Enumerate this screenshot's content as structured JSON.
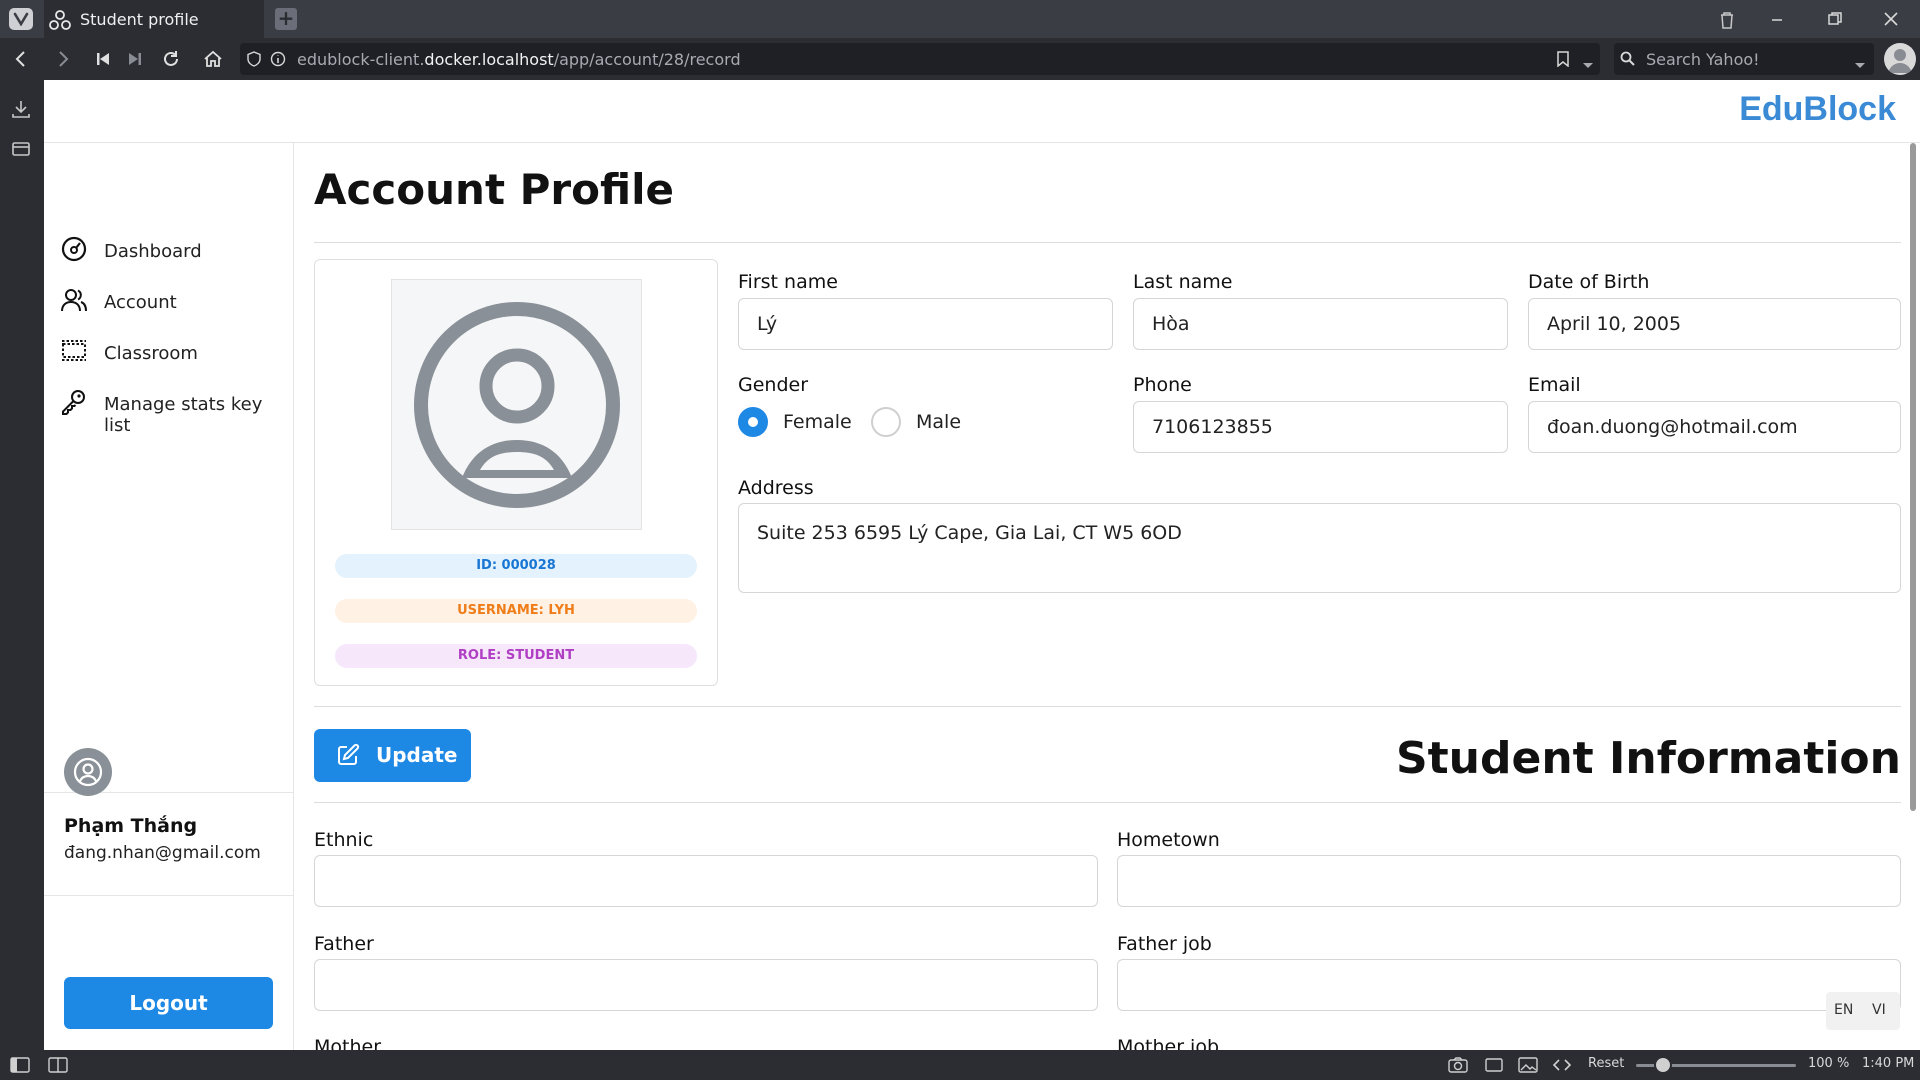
{
  "browser": {
    "tab_title": "Student profile",
    "url_prefix": "edublock-client.",
    "url_host": "docker.localhost",
    "url_path": "/app/account/28/record",
    "search_placeholder": "Search Yahoo!",
    "status": {
      "reset_label": "Reset",
      "zoom": "100 %",
      "time": "1:40 PM"
    }
  },
  "app": {
    "brand": "EduBlock",
    "nav": [
      {
        "label": "Dashboard",
        "icon": "dashboard-icon"
      },
      {
        "label": "Account",
        "icon": "users-icon"
      },
      {
        "label": "Classroom",
        "icon": "classroom-icon"
      },
      {
        "label": "Manage stats key list",
        "icon": "key-icon"
      }
    ],
    "user": {
      "name": "Phạm Thắng",
      "email": "đang.nhan@gmail.com"
    },
    "logout_label": "Logout"
  },
  "profile": {
    "title": "Account Profile",
    "badges": {
      "id": "ID: 000028",
      "username": "USERNAME: LYH",
      "role": "ROLE: STUDENT"
    },
    "fields": {
      "first_name": {
        "label": "First name",
        "value": "Lý"
      },
      "last_name": {
        "label": "Last name",
        "value": "Hòa"
      },
      "dob": {
        "label": "Date of Birth",
        "value": "April 10, 2005"
      },
      "gender": {
        "label": "Gender",
        "options": [
          "Female",
          "Male"
        ],
        "selected": "Female"
      },
      "phone": {
        "label": "Phone",
        "value": "7106123855"
      },
      "email": {
        "label": "Email",
        "value": "đoan.duong@hotmail.com"
      },
      "address": {
        "label": "Address",
        "value": "Suite 253 6595 Lý Cape, Gia Lai, CT W5  6OD"
      }
    },
    "update_label": "Update"
  },
  "student_info": {
    "title": "Student Information",
    "fields": {
      "ethnic": {
        "label": "Ethnic",
        "value": ""
      },
      "hometown": {
        "label": "Hometown",
        "value": ""
      },
      "father": {
        "label": "Father",
        "value": ""
      },
      "father_job": {
        "label": "Father job",
        "value": ""
      },
      "mother": {
        "label": "Mother",
        "value": ""
      },
      "mother_job": {
        "label": "Mother job",
        "value": ""
      }
    }
  },
  "lang": {
    "en": "EN",
    "vi": "VI"
  },
  "colors": {
    "primary": "#1e88e5",
    "brand": "#3a8ad6",
    "id_badge": "#1976d2",
    "username_badge": "#ef7d1a",
    "role_badge": "#b03fc4"
  }
}
